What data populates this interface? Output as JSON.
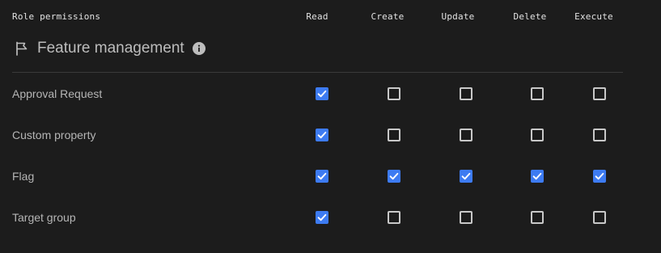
{
  "header": {
    "title": "Role permissions",
    "columns": [
      "Read",
      "Create",
      "Update",
      "Delete",
      "Execute"
    ]
  },
  "section": {
    "title": "Feature management",
    "icon": "flag-icon",
    "info_icon": "info-icon"
  },
  "colors": {
    "background": "#1c1c1c",
    "checkbox_checked": "#3d7bf2",
    "checkbox_border": "#c8c8c8"
  },
  "rows": [
    {
      "label": "Approval Request",
      "permissions": [
        true,
        false,
        false,
        false,
        false
      ]
    },
    {
      "label": "Custom property",
      "permissions": [
        true,
        false,
        false,
        false,
        false
      ]
    },
    {
      "label": "Flag",
      "permissions": [
        true,
        true,
        true,
        true,
        true
      ]
    },
    {
      "label": "Target group",
      "permissions": [
        true,
        false,
        false,
        false,
        false
      ]
    }
  ]
}
